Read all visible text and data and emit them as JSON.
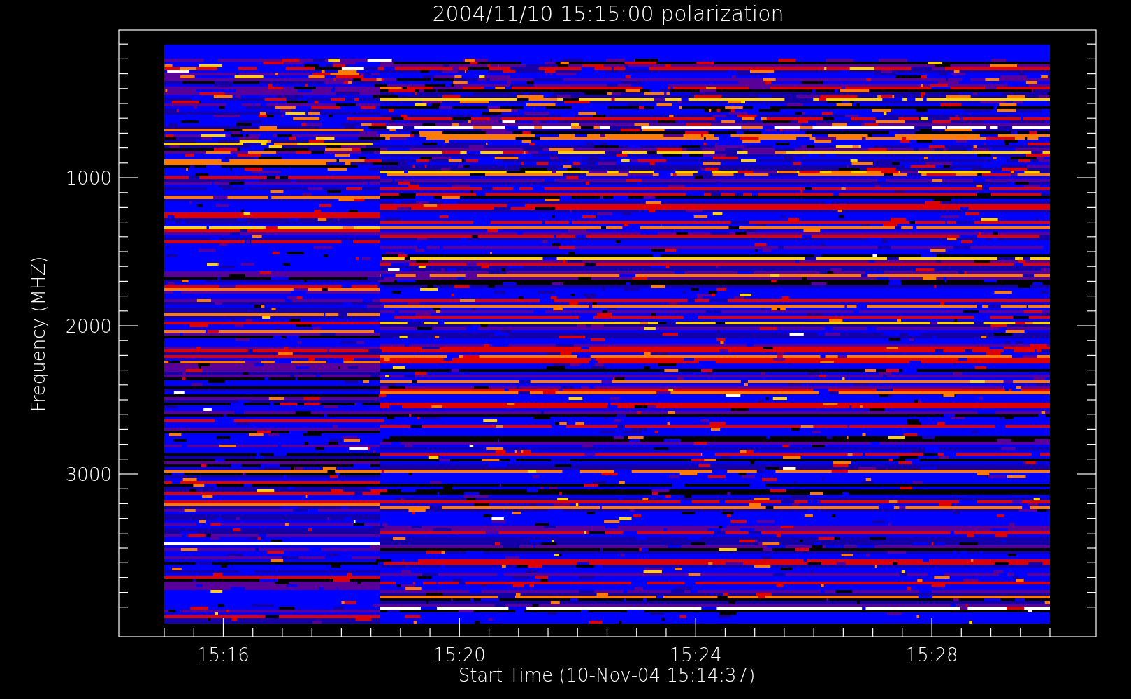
{
  "title": "2004/11/10 15:15:00 polarization",
  "ylabel": "Frequency (MHZ)",
  "xlabel": "Start Time (10-Nov-04 15:14:37)",
  "yticks": [
    "1000",
    "2000",
    "3000"
  ],
  "xticks": [
    "15:16",
    "15:20",
    "15:24",
    "15:28"
  ]
}
